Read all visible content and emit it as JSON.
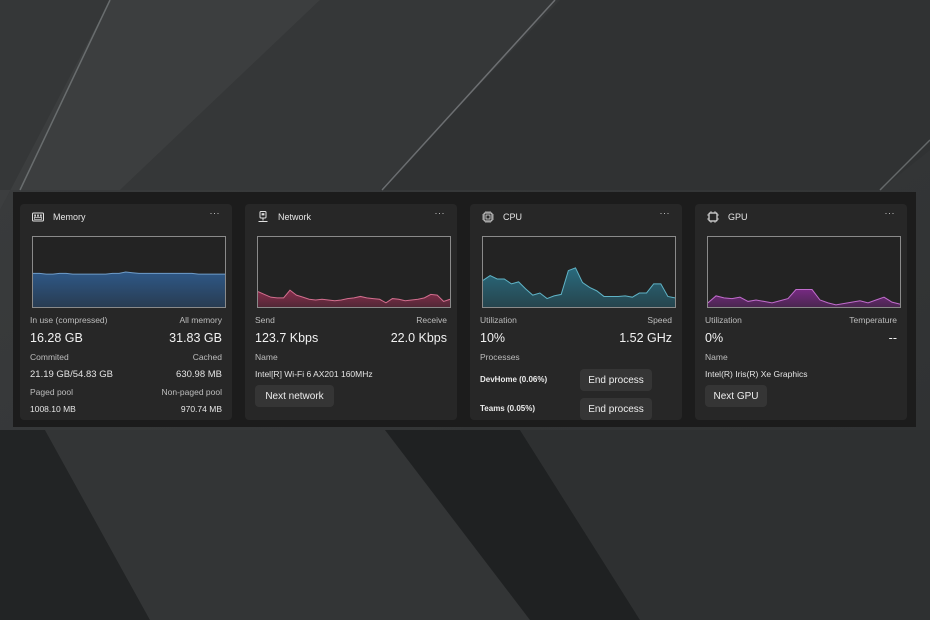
{
  "widgets": {
    "memory": {
      "title": "Memory",
      "icon": "memory-chip-icon",
      "more": "···",
      "accent": "#2f5b8c",
      "in_use_label": "In use (compressed)",
      "in_use_value": "16.28 GB",
      "all_memory_label": "All memory",
      "all_memory_value": "31.83 GB",
      "committed_label": "Commited",
      "committed_value": "21.19 GB/54.83 GB",
      "cached_label": "Cached",
      "cached_value": "630.98 MB",
      "paged_pool_label": "Paged pool",
      "paged_pool_value": "1008.10 MB",
      "non_paged_pool_label": "Non-paged pool",
      "non_paged_pool_value": "970.74 MB"
    },
    "network": {
      "title": "Network",
      "icon": "ethernet-port-icon",
      "more": "···",
      "accent": "#8c2e4e",
      "send_label": "Send",
      "send_value": "123.7 Kbps",
      "receive_label": "Receive",
      "receive_value": "22.0 Kbps",
      "name_label": "Name",
      "name_value": "Intel[R] Wi-Fi 6 AX201 160MHz",
      "next_button": "Next network"
    },
    "cpu": {
      "title": "CPU",
      "icon": "cpu-chip-icon",
      "more": "···",
      "accent": "#2a6e82",
      "utilization_label": "Utilization",
      "utilization_value": "10%",
      "speed_label": "Speed",
      "speed_value": "1.52 GHz",
      "processes_label": "Processes",
      "processes": [
        {
          "name": "DevHome (0.06%)",
          "button": "End process"
        },
        {
          "name": "Teams (0.05%)",
          "button": "End process"
        }
      ]
    },
    "gpu": {
      "title": "GPU",
      "icon": "gpu-chip-icon",
      "more": "···",
      "accent": "#7a2a86",
      "utilization_label": "Utilization",
      "utilization_value": "0%",
      "temperature_label": "Temperature",
      "temperature_value": "--",
      "name_label": "Name",
      "name_value": "Intel(R) Iris(R) Xe Graphics",
      "next_button": "Next GPU"
    }
  },
  "chart_data": [
    {
      "type": "area",
      "title": "Memory",
      "ylim": [
        0,
        100
      ],
      "color": "#2f5b8c",
      "line_color": "#6f9cc8",
      "values": [
        48,
        48,
        47,
        47,
        48,
        48,
        47,
        47,
        47,
        47,
        47,
        47,
        48,
        48,
        50,
        49,
        48,
        48,
        48,
        48,
        48,
        48,
        48,
        48,
        48,
        47,
        47,
        47,
        47,
        47
      ]
    },
    {
      "type": "area",
      "title": "Network",
      "ylim": [
        0,
        100
      ],
      "color": "#8c2e4e",
      "line_color": "#d26e8e",
      "values": [
        22,
        18,
        14,
        13,
        13,
        24,
        17,
        14,
        11,
        10,
        11,
        10,
        9,
        10,
        12,
        13,
        15,
        13,
        12,
        11,
        6,
        12,
        11,
        9,
        10,
        11,
        13,
        18,
        17,
        8,
        11
      ]
    },
    {
      "type": "area",
      "title": "CPU",
      "ylim": [
        0,
        100
      ],
      "color": "#2a6e82",
      "line_color": "#5fb3c6",
      "values": [
        38,
        45,
        40,
        40,
        33,
        36,
        26,
        17,
        20,
        12,
        16,
        18,
        52,
        56,
        35,
        28,
        23,
        15,
        15,
        15,
        16,
        14,
        20,
        20,
        33,
        33,
        15,
        13
      ]
    },
    {
      "type": "area",
      "title": "GPU",
      "ylim": [
        0,
        100
      ],
      "color": "#7a2a86",
      "line_color": "#c06ccc",
      "values": [
        6,
        16,
        13,
        12,
        14,
        8,
        10,
        8,
        6,
        9,
        12,
        25,
        25,
        25,
        10,
        6,
        3,
        5,
        7,
        9,
        6,
        10,
        14,
        7,
        4
      ]
    }
  ]
}
